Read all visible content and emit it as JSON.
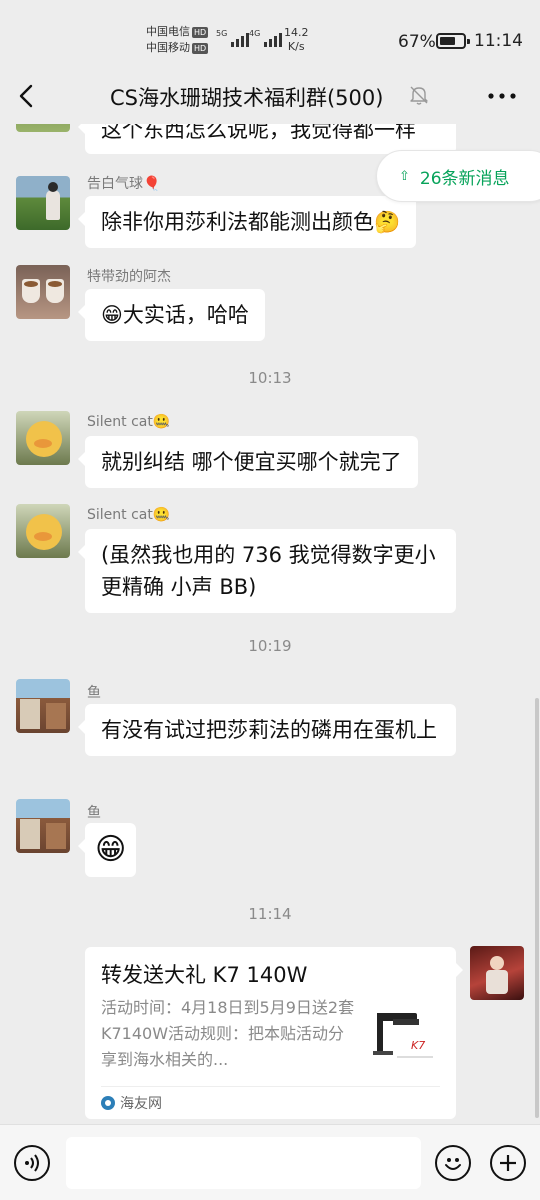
{
  "status_bar": {
    "carrier_1": "中国电信",
    "carrier_2": "中国移动",
    "hd_badge": "HD",
    "signal_1_label": "5G",
    "signal_2_label": "4G",
    "net_speed_value": "14.2",
    "net_speed_unit": "K/s",
    "battery_percent": "67%",
    "battery_level": 0.67,
    "time": "11:14"
  },
  "header": {
    "title": "CS海水珊瑚技术福利群(500)",
    "icons": [
      "back-icon",
      "mute-bell-icon",
      "more-icon"
    ]
  },
  "new_messages_pill": {
    "label": "26条新消息"
  },
  "messages": [
    {
      "type": "text",
      "text": "这个东西怎么说呢，我觉得都一样"
    },
    {
      "type": "text",
      "sender": "告白气球🎈",
      "text": "除非你用莎利法都能测出颜色🤔"
    },
    {
      "type": "text",
      "sender": "特带劲的阿杰",
      "text": "😁大实话，哈哈"
    },
    {
      "type": "time",
      "text": "10:13"
    },
    {
      "type": "text",
      "sender": "Silent cat🤐",
      "text": "就别纠结 哪个便宜买哪个就完了"
    },
    {
      "type": "text",
      "sender": "Silent cat🤐",
      "text": "(虽然我也用的 736 我觉得数字更小更精确 小声 BB)"
    },
    {
      "type": "time",
      "text": "10:19"
    },
    {
      "type": "text",
      "sender": "鱼",
      "text": "有没有试过把莎莉法的磷用在蛋机上"
    },
    {
      "type": "emoji",
      "sender": "鱼",
      "text": "😁"
    },
    {
      "type": "time",
      "text": "11:14"
    },
    {
      "type": "link",
      "title": "转发送大礼 K7 140W",
      "description": "活动时间：4月18日到5月9日送2套K7140W活动规则：把本贴活动分享到海水相关的...",
      "source": "海友网",
      "thumb_text": "K7"
    }
  ],
  "input_bar": {
    "placeholder": "",
    "icons": [
      "voice-icon",
      "emoji-icon",
      "plus-icon"
    ]
  }
}
